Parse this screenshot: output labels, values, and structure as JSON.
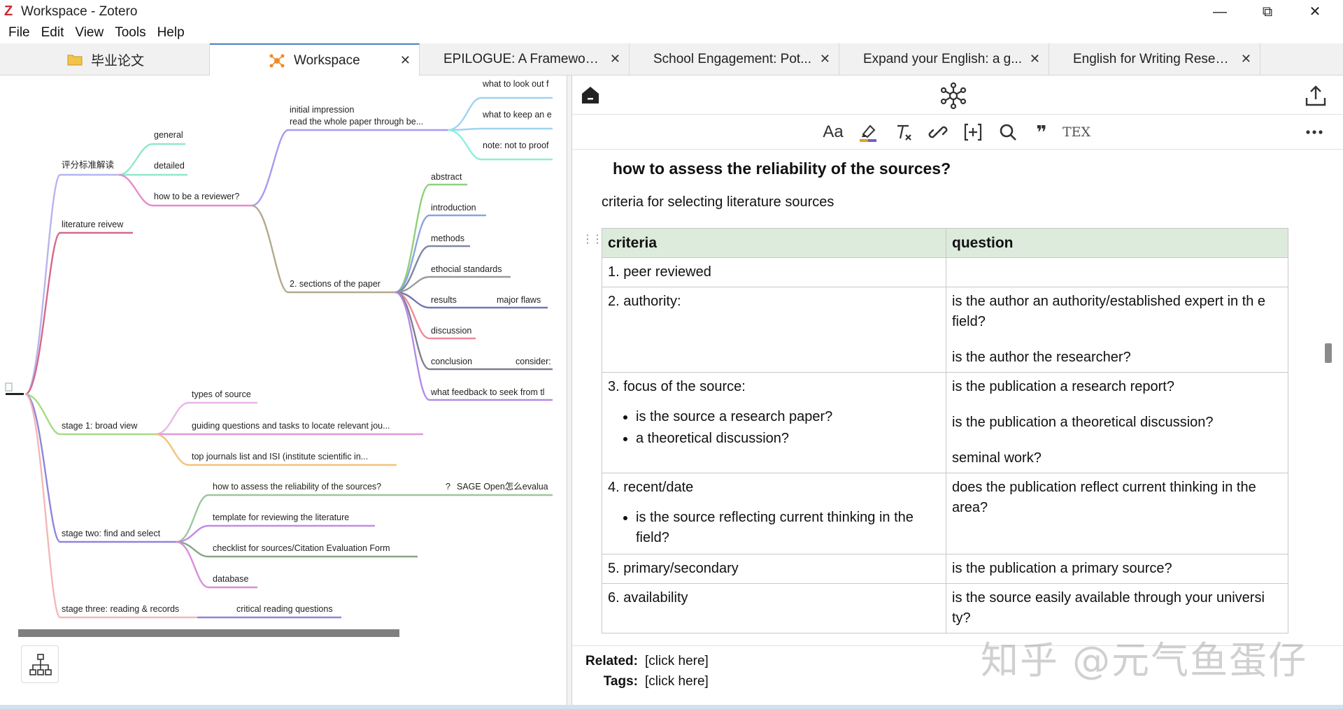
{
  "window": {
    "title": "Workspace - Zotero",
    "logo": "Z",
    "controls": {
      "minimize": "—",
      "restore": "⧉",
      "close": "✕"
    }
  },
  "menu": [
    "File",
    "Edit",
    "View",
    "Tools",
    "Help"
  ],
  "tabs": [
    {
      "label": "毕业论文",
      "icon": "folder-icon",
      "active": false
    },
    {
      "label": "Workspace",
      "icon": "mindmap-icon",
      "active": true
    },
    {
      "label": "EPILOGUE: A Framework ...",
      "active": false
    },
    {
      "label": "School Engagement: Pot...",
      "active": false
    },
    {
      "label": "Expand your English: a g...",
      "active": false
    },
    {
      "label": "English for Writing Resea...",
      "active": false
    }
  ],
  "mindmap": {
    "nodes": {
      "pingfen": "评分标准解读",
      "general": "general",
      "detailed": "detailed",
      "how_reviewer": "how to be a reviewer?",
      "initial1": "initial impression",
      "initial2": "read the whole paper through be...",
      "look_out": "what to look out f",
      "keep_an": "what to keep an e",
      "note_proof": "note: not to proof",
      "sections": "2. sections of the paper",
      "abstract": "abstract",
      "introduction": "introduction",
      "methods": "methods",
      "ethical": "ethocial standards",
      "results": "results",
      "major_flaws": "major flaws",
      "discussion": "discussion",
      "conclusion": "conclusion",
      "consider": "consider:",
      "feedback": "what feedback to seek from tl",
      "lit_review": "literature reivew",
      "stage1": "stage 1:   broad view",
      "types_source": "types of source",
      "guiding": "guiding questions and tasks to locate relevant jou...",
      "top_journals": "top journals list and ISI (institute scientific in...",
      "stage2": "stage two: find and select",
      "how_assess": "how to assess the reliability of the sources?",
      "sage": "SAGE Open怎么evalua",
      "template": "template for reviewing the literature",
      "checklist": "checklist for sources/Citation Evaluation Form",
      "database": "database",
      "stage3": "stage three: reading & records",
      "critical": "critical reading questions"
    }
  },
  "note": {
    "heading": "how to assess the reliability of the sources?",
    "intro": "criteria for selecting literature sources",
    "table": {
      "headers": [
        "criteria",
        "question"
      ],
      "rows": [
        {
          "criteria": "1. peer reviewed",
          "bullets": [],
          "questions": []
        },
        {
          "criteria": "2. authority:",
          "bullets": [],
          "questions": [
            "is the author an authority/established expert in th e field?",
            "is the author the researcher?"
          ]
        },
        {
          "criteria": "3. focus of the source:",
          "bullets": [
            "is the source a research paper?",
            "a theoretical discussion?"
          ],
          "questions": [
            "is the publication a research report?",
            "is the publication a theoretical discussion?",
            "seminal work?"
          ]
        },
        {
          "criteria": "4. recent/date",
          "bullets": [
            "is the source reflecting current thinking in the field?"
          ],
          "questions": [
            "does the publication reflect current thinking in the area?"
          ]
        },
        {
          "criteria": "5. primary/secondary",
          "bullets": [],
          "questions": [
            "is the publication a primary source?"
          ]
        },
        {
          "criteria": "6. availability",
          "bullets": [],
          "questions": [
            "is the source easily available through your universi ty?"
          ]
        }
      ]
    },
    "footer": {
      "related_label": "Related:",
      "related_value": "[click here]",
      "tags_label": "Tags:",
      "tags_value": "[click here]"
    }
  },
  "toolbar": {
    "text_format": "Aa",
    "tex": "TEX",
    "quote": "❞"
  },
  "watermark": "知乎 @元气鱼蛋仔"
}
